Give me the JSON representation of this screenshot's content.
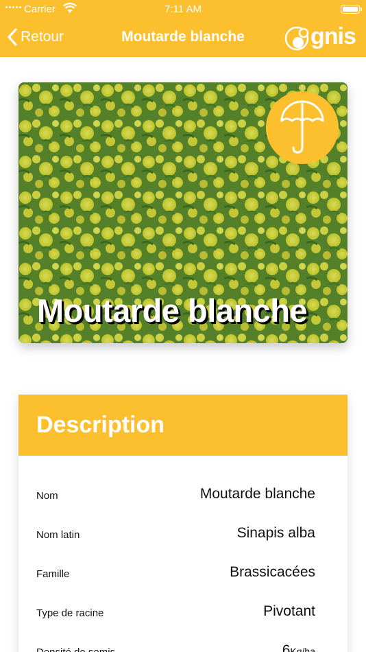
{
  "status_bar": {
    "carrier": "Carrier",
    "time": "7:11 AM"
  },
  "nav": {
    "back_label": "Retour",
    "title": "Moutarde blanche",
    "logo_text": "gnis"
  },
  "hero": {
    "title": "Moutarde blanche",
    "badge_icon": "umbrella-icon"
  },
  "description": {
    "heading": "Description",
    "rows": [
      {
        "key": "Nom",
        "value": "Moutarde blanche"
      },
      {
        "key": "Nom latin",
        "value": "Sinapis alba"
      },
      {
        "key": "Famille",
        "value": "Brassicacées"
      },
      {
        "key": "Type de racine",
        "value": "Pivotant"
      },
      {
        "key": "Densité de semis",
        "value": "6",
        "unit": "Kg/ha"
      }
    ]
  },
  "colors": {
    "accent": "#fcc02e"
  }
}
